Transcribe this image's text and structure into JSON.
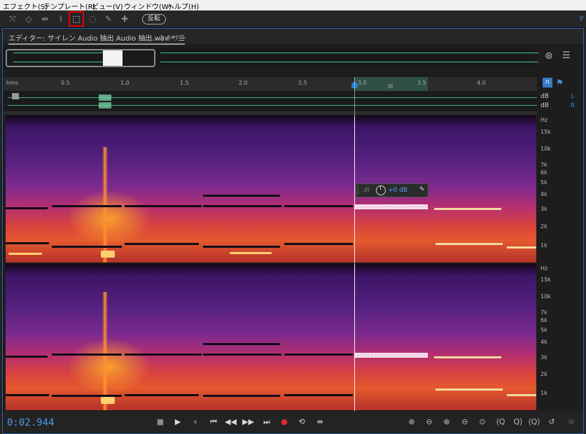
{
  "menu": [
    "エフェクト(S)",
    "テンプレート(R)",
    "ビュー(V)",
    "ウィンドウ(W)",
    "ヘルプ(H)"
  ],
  "toolbar": {
    "tools": [
      {
        "name": "move-tool-icon",
        "glyph": "⤧"
      },
      {
        "name": "razor-tool-icon",
        "glyph": "◇"
      },
      {
        "name": "slip-tool-icon",
        "glyph": "⇹"
      },
      {
        "name": "time-selection-tool-icon",
        "glyph": "I"
      },
      {
        "name": "marquee-selection-tool-icon",
        "glyph": "⬚"
      },
      {
        "name": "lasso-tool-icon",
        "glyph": "◌"
      },
      {
        "name": "brush-tool-icon",
        "glyph": "✎"
      },
      {
        "name": "spot-healing-brush-icon",
        "glyph": "✚"
      }
    ],
    "invert_label": "反転",
    "right_tag": "デ"
  },
  "tabs": {
    "editor": "エディター: サイレン Audio 抽出 Audio 抽出.wav *",
    "editor_menu": "☰",
    "mixer": "ミキサー"
  },
  "ruler": {
    "unit": "hms",
    "ticks": [
      "0.5",
      "1.0",
      "1.5",
      "2.0",
      "2.5",
      "3.0",
      "3.5",
      "4.0"
    ],
    "selection_label": "III"
  },
  "channels": {
    "db": "dB",
    "left": "L",
    "right": "R"
  },
  "frequency_axis": {
    "unit": "Hz",
    "labels": [
      "15k",
      "10k",
      "7k",
      "6k",
      "5k",
      "4k",
      "3k",
      "2k",
      "1k"
    ]
  },
  "hud": {
    "value": "+0 dB"
  },
  "transport": {
    "timecode": "0:02.944",
    "buttons": [
      {
        "name": "stop-button",
        "glyph": "■"
      },
      {
        "name": "play-button",
        "glyph": "▶"
      },
      {
        "name": "pause-button",
        "glyph": "⏸"
      },
      {
        "name": "go-to-start-button",
        "glyph": "⏮"
      },
      {
        "name": "rewind-button",
        "glyph": "◀◀"
      },
      {
        "name": "fast-forward-button",
        "glyph": "▶▶"
      },
      {
        "name": "go-to-end-button",
        "glyph": "⏭"
      },
      {
        "name": "record-button",
        "glyph": "●"
      },
      {
        "name": "loop-playback-button",
        "glyph": "⟲"
      },
      {
        "name": "skip-selection-button",
        "glyph": "⇹"
      }
    ],
    "zoom_buttons": [
      {
        "name": "zoom-in-amplitude-button",
        "glyph": "⊕"
      },
      {
        "name": "zoom-out-amplitude-button",
        "glyph": "⊖"
      },
      {
        "name": "zoom-in-time-button",
        "glyph": "⊕"
      },
      {
        "name": "zoom-out-time-button",
        "glyph": "⊖"
      },
      {
        "name": "zoom-out-full-button",
        "glyph": "⊙"
      },
      {
        "name": "zoom-in-at-start-button",
        "glyph": "⟨Q"
      },
      {
        "name": "zoom-in-at-end-button",
        "glyph": "Q⟩"
      },
      {
        "name": "zoom-to-selection-button",
        "glyph": "⟨Q⟩"
      },
      {
        "name": "zoom-reset-button",
        "glyph": "↺"
      },
      {
        "name": "zoom-disabled-button",
        "glyph": "⊕"
      }
    ]
  }
}
